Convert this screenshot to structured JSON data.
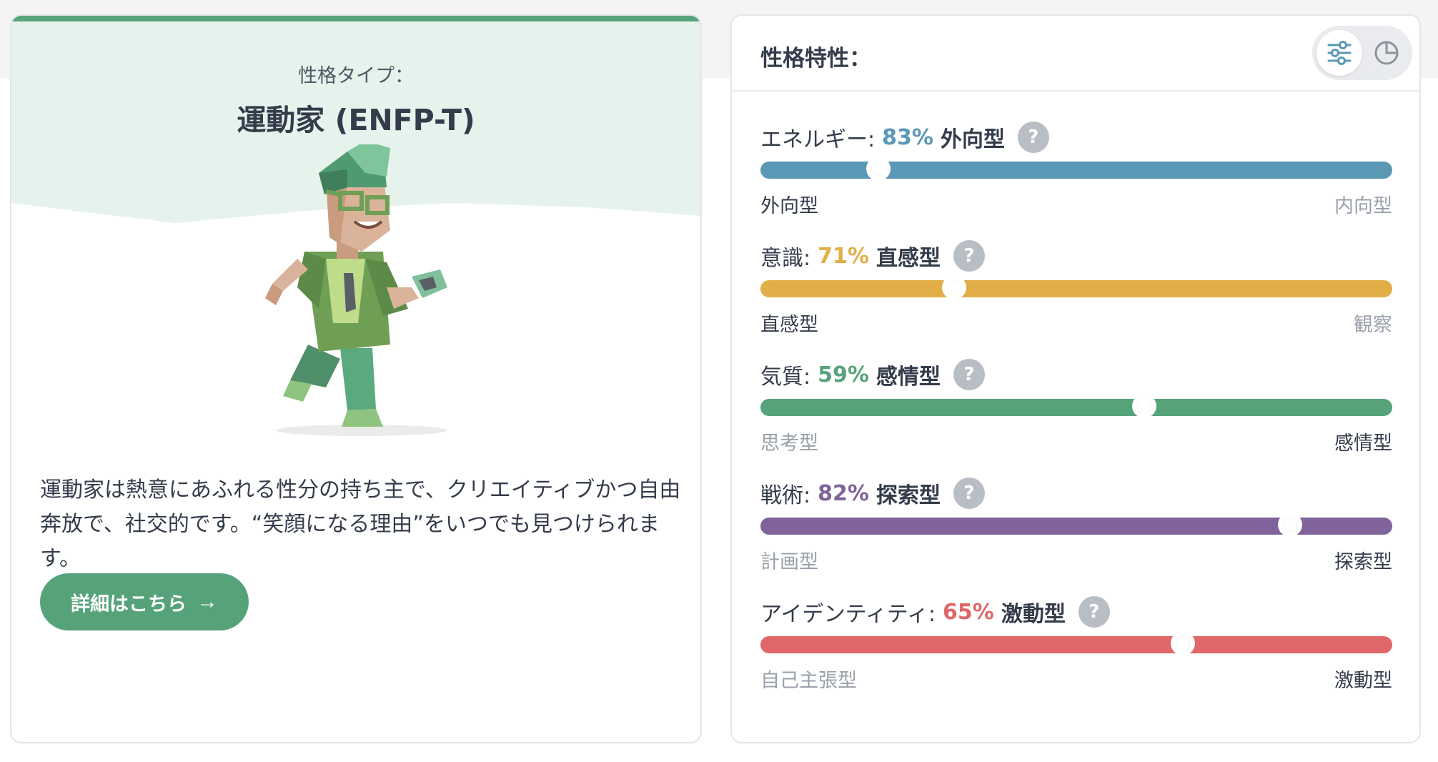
{
  "colors": {
    "brand_green": "#56a37a",
    "energy": "#5a98b6",
    "mind": "#e2ae48",
    "nature": "#56a37a",
    "tactics": "#80639a",
    "identity": "#e06767"
  },
  "type_card": {
    "kicker": "性格タイプ：",
    "type_name": "運動家 (ENFP-T)",
    "avatar_icon": "campaigner-avatar-illustration",
    "description": "運動家は熱意にあふれる性分の持ち主で、クリエイティブかつ自由奔放で、社交的です。“笑顔になる理由”をいつでも見つけられます。",
    "more_label": "詳細はこちら",
    "more_icon": "arrow-right-icon"
  },
  "traits_card": {
    "title": "性格特性：",
    "toggle": {
      "sliders_icon": "sliders-icon",
      "pie_icon": "pie-chart-icon"
    },
    "traits": [
      {
        "name": "エネルギー:",
        "percent": "83%",
        "side": "外向型",
        "left_pole": "外向型",
        "right_pole": "内向型",
        "knob_position": 0.187,
        "dominant": "left",
        "color_key": "energy",
        "help": "?"
      },
      {
        "name": "意識:",
        "percent": "71%",
        "side": "直感型",
        "left_pole": "直感型",
        "right_pole": "観察",
        "knob_position": 0.307,
        "dominant": "left",
        "color_key": "mind",
        "help": "?"
      },
      {
        "name": "気質:",
        "percent": "59%",
        "side": "感情型",
        "left_pole": "思考型",
        "right_pole": "感情型",
        "knob_position": 0.607,
        "dominant": "right",
        "color_key": "nature",
        "help": "?"
      },
      {
        "name": "戦術:",
        "percent": "82%",
        "side": "探索型",
        "left_pole": "計画型",
        "right_pole": "探索型",
        "knob_position": 0.838,
        "dominant": "right",
        "color_key": "tactics",
        "help": "?"
      },
      {
        "name": "アイデンティティ:",
        "percent": "65%",
        "side": "激動型",
        "left_pole": "自己主張型",
        "right_pole": "激動型",
        "knob_position": 0.668,
        "dominant": "right",
        "color_key": "identity",
        "help": "?"
      }
    ]
  }
}
